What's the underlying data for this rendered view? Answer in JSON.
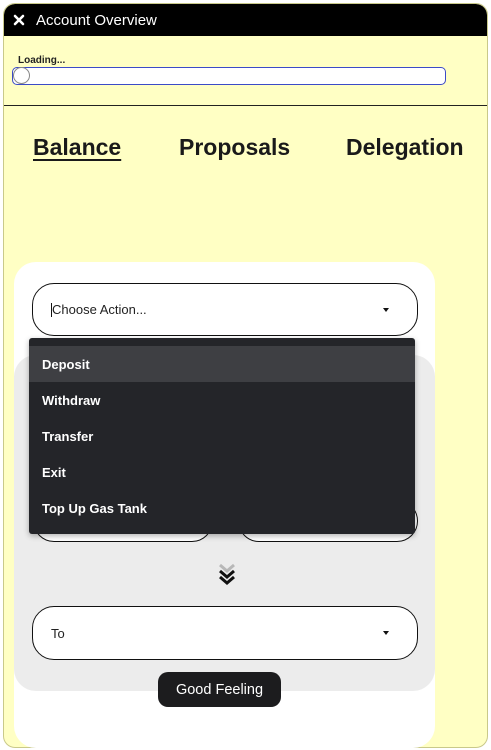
{
  "window": {
    "title": "Account Overview",
    "close_icon": "close-icon"
  },
  "loader": {
    "label": "Loading...",
    "progress": 0
  },
  "tabs": [
    {
      "label": "Balance",
      "active": true
    },
    {
      "label": "Proposals",
      "active": false
    },
    {
      "label": "Delegation",
      "active": false
    }
  ],
  "action_select": {
    "placeholder": "Choose Action..."
  },
  "dropdown": {
    "items": [
      {
        "label": "Deposit",
        "highlighted": true
      },
      {
        "label": "Withdraw"
      },
      {
        "label": "Transfer"
      },
      {
        "label": "Exit"
      },
      {
        "label": "Top Up Gas Tank"
      }
    ]
  },
  "to_select": {
    "label": "To"
  },
  "swap_icon": "double-chevron-down-icon",
  "tooltip": {
    "text": "Good Feeling"
  },
  "colors": {
    "background": "#ffffc4",
    "titlebar": "#000000",
    "dropdown": "#242529",
    "panel": "#ececec"
  }
}
